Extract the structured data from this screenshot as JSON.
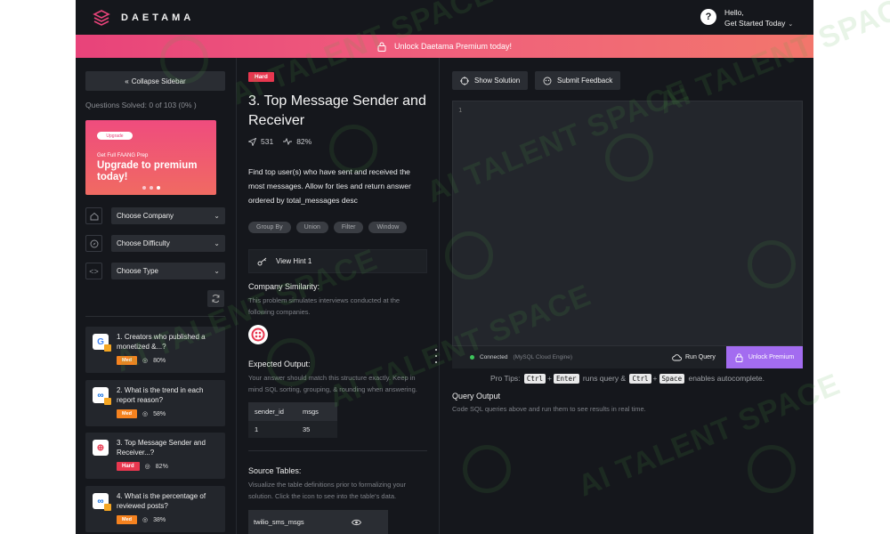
{
  "app": {
    "brand": "DAETAMA",
    "help_label": "?",
    "user_greeting": "Hello,",
    "user_menu": "Get Started Today",
    "banner_text": "Unlock Daetama Premium today!"
  },
  "sidebar": {
    "collapse_label": "Collapse Sidebar",
    "solved_text": "Questions Solved: 0 of 103 (0% )",
    "promo": {
      "pill": "Upgrade",
      "small": "Get Full FAANG Prep",
      "big": "Upgrade to premium today!",
      "active_slide": 3,
      "total_slides": 3
    },
    "filters": [
      {
        "label": "Choose Company",
        "icon": "home-icon"
      },
      {
        "label": "Choose Difficulty",
        "icon": "compass-icon"
      },
      {
        "label": "Choose Type",
        "icon": "code-icon"
      }
    ],
    "questions": [
      {
        "title": "1. Creators who published a monetized &...?",
        "difficulty": "Med",
        "rate": "80%",
        "company": "google-logo",
        "logo_text": "G",
        "locked": true
      },
      {
        "title": "2. What is the trend in each report reason?",
        "difficulty": "Med",
        "rate": "58%",
        "company": "meta-logo",
        "logo_text": "∞",
        "locked": true
      },
      {
        "title": "3. Top Message Sender and Receiver...?",
        "difficulty": "Hard",
        "rate": "82%",
        "company": "twilio-logo",
        "logo_text": "⊕",
        "locked": false
      },
      {
        "title": "4. What is the percentage of reviewed posts?",
        "difficulty": "Med",
        "rate": "38%",
        "company": "meta-logo",
        "logo_text": "∞",
        "locked": true
      }
    ]
  },
  "question": {
    "difficulty": "Hard",
    "title": "3. Top Message Sender and Receiver",
    "submissions": "531",
    "success_rate": "82%",
    "description": "Find top user(s) who have sent and received the most messages. Allow for ties and return answer ordered by total_messages desc",
    "tags": [
      "Group By",
      "Union",
      "Filter",
      "Window"
    ],
    "hint_label": "View Hint 1",
    "company_similarity_title": "Company Similarity:",
    "company_similarity_desc": "This problem simulates interviews conducted at the following companies.",
    "expected_output_title": "Expected Output:",
    "expected_output_desc": "Your answer should match this structure exactly. Keep in mind SQL sorting, grouping, & rounding when answering.",
    "output_table": {
      "headers": [
        "sender_id",
        "msgs"
      ],
      "rows": [
        [
          "1",
          "35"
        ]
      ]
    },
    "source_tables_title": "Source Tables:",
    "source_tables_desc": "Visualize the table definitions prior to formalizing your solution. Click the icon to see into the table's data.",
    "source_table_name": "twilio_sms_msgs"
  },
  "editor": {
    "show_solution": "Show Solution",
    "submit_feedback": "Submit Feedback",
    "line_number": "1",
    "connection_status": "Connected",
    "engine": "(MySQL Cloud Engine)",
    "run_label": "Run Query",
    "unlock_label": "Unlock Premium",
    "protips_prefix": "Pro Tips:",
    "key_ctrl": "Ctrl",
    "key_enter": "Enter",
    "key_space": "Space",
    "protips_mid": "runs query &",
    "protips_end": "enables autocomplete.",
    "plus": "+",
    "query_output_title": "Query Output",
    "query_output_desc": "Code SQL queries above and run them to see results in real time."
  },
  "watermark": {
    "text": "AI TALENT SPACE"
  },
  "colors": {
    "background": "#15171c",
    "banner_start": "#e8437a",
    "banner_end": "#f2766c",
    "hard": "#e8374f",
    "medium": "#f5821f",
    "premium": "#a36cf0",
    "connected": "#3ec45c"
  }
}
